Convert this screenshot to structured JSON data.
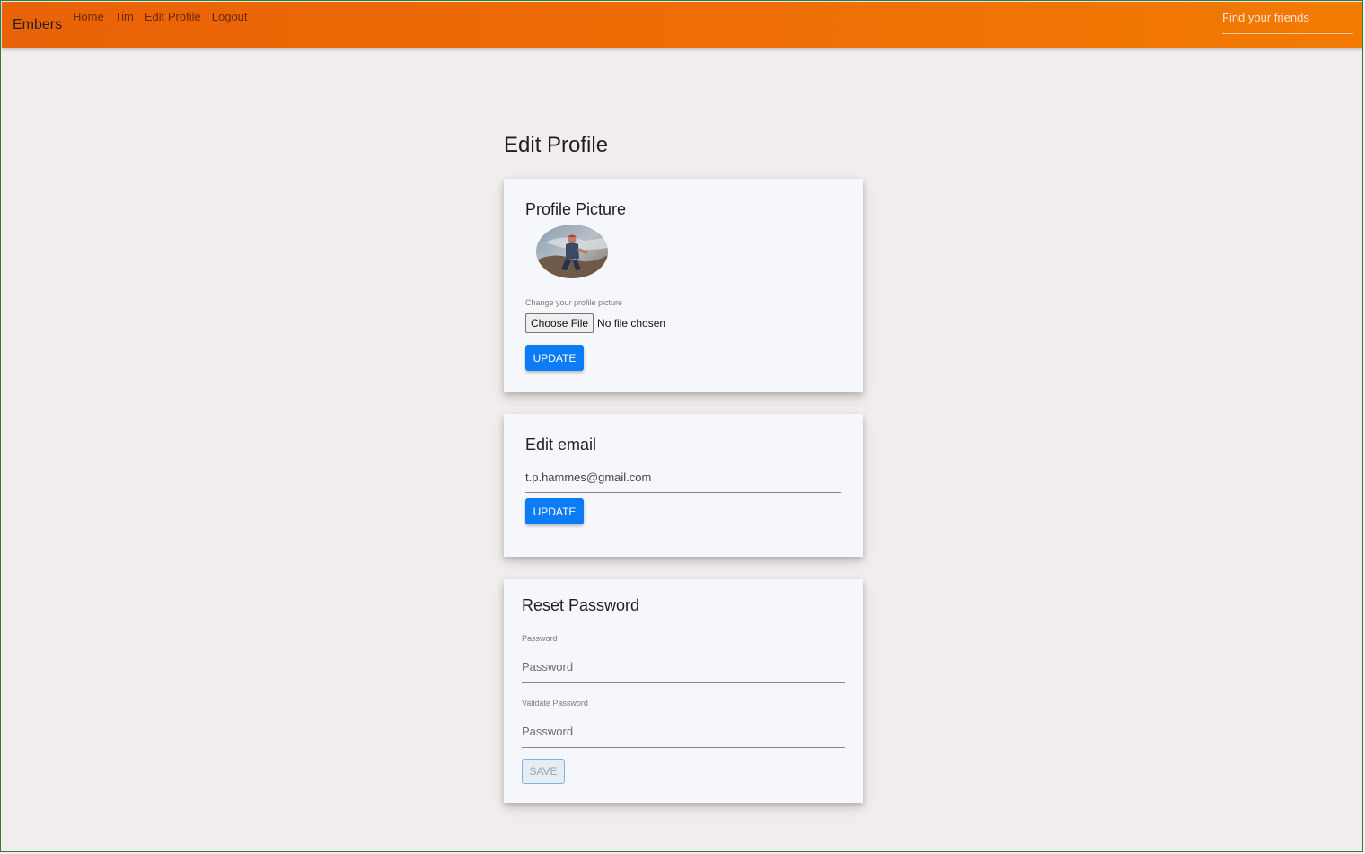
{
  "navbar": {
    "brand": "Embers",
    "links": [
      "Home",
      "Tim",
      "Edit Profile",
      "Logout"
    ],
    "search_placeholder": "Find your friends"
  },
  "page": {
    "title": "Edit Profile"
  },
  "profile_picture_card": {
    "title": "Profile Picture",
    "change_label": "Change your profile picture",
    "file_button": "Choose File",
    "file_status": "No file chosen",
    "update_label": "UPDATE"
  },
  "email_card": {
    "title": "Edit email",
    "email_value": "t.p.hammes@gmail.com",
    "update_label": "UPDATE"
  },
  "password_card": {
    "title": "Reset Password",
    "password_label": "Password",
    "password_placeholder": "Password",
    "validate_label": "Validate Password",
    "validate_placeholder": "Password",
    "save_label": "SAVE"
  },
  "colors": {
    "navbar_start": "#ea6207",
    "navbar_end": "#f27a02",
    "primary_button": "#0b7cf6",
    "page_background": "#f2eded",
    "card_background": "#f6f7fb"
  }
}
